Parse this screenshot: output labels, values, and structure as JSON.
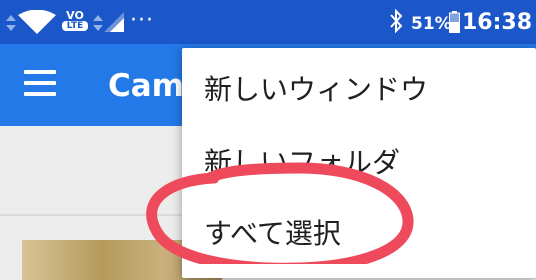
{
  "status_bar": {
    "volte_top": "VO",
    "volte_bottom": "LTE",
    "notifications_more": "···",
    "battery_percent": "51%",
    "time": "16:38",
    "icons": [
      "data-arrows-icon",
      "wifi-icon",
      "volte-icon",
      "signal-icon",
      "bluetooth-icon",
      "battery-icon"
    ]
  },
  "app_bar": {
    "menu_icon": "hamburger-menu-icon",
    "title": "Camera"
  },
  "overflow_menu": {
    "items": [
      {
        "label": "新しいウィンドウ"
      },
      {
        "label": "新しいフォルダ"
      },
      {
        "label": "すべて選択"
      }
    ]
  },
  "colors": {
    "status_bar": "#1c57c9",
    "app_bar": "#2379e8",
    "background": "#ececec",
    "annotation": "#ef4a5c"
  }
}
